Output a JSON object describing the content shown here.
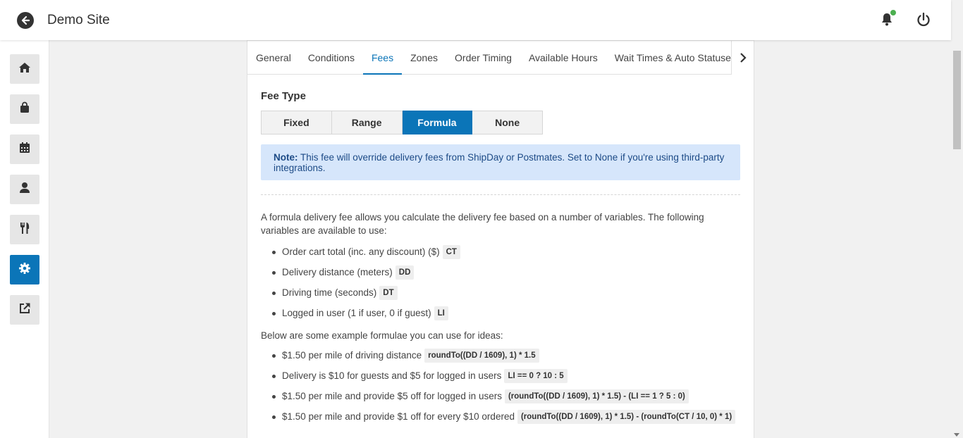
{
  "header": {
    "title": "Demo Site"
  },
  "sidebar": {
    "items": [
      {
        "icon": "home-icon",
        "active": false
      },
      {
        "icon": "shopping-bag-icon",
        "active": false
      },
      {
        "icon": "calendar-icon",
        "active": false
      },
      {
        "icon": "user-icon",
        "active": false
      },
      {
        "icon": "utensils-icon",
        "active": false
      },
      {
        "icon": "gear-icon",
        "active": true
      },
      {
        "icon": "external-link-icon",
        "active": false
      }
    ]
  },
  "tabs": [
    "General",
    "Conditions",
    "Fees",
    "Zones",
    "Order Timing",
    "Available Hours",
    "Wait Times & Auto Statuses"
  ],
  "active_tab": "Fees",
  "fee_type": {
    "label": "Fee Type",
    "options": [
      "Fixed",
      "Range",
      "Formula",
      "None"
    ],
    "selected": "Formula"
  },
  "note": {
    "title": "Note:",
    "text": "This fee will override delivery fees from ShipDay or Postmates. Set to None if you're using third-party integrations."
  },
  "intro": "A formula delivery fee allows you calculate the delivery fee based on a number of variables. The following variables are available to use:",
  "variables": [
    {
      "text": "Order cart total (inc. any discount) ($)",
      "code": "CT"
    },
    {
      "text": "Delivery distance (meters)",
      "code": "DD"
    },
    {
      "text": "Driving time (seconds)",
      "code": "DT"
    },
    {
      "text": "Logged in user (1 if user, 0 if guest)",
      "code": "LI"
    }
  ],
  "examples_intro": "Below are some example formulae you can use for ideas:",
  "examples": [
    {
      "text": "$1.50 per mile of driving distance",
      "code": "roundTo((DD / 1609), 1) * 1.5"
    },
    {
      "text": "Delivery is $10 for guests and $5 for logged in users",
      "code": "LI == 0 ? 10 : 5"
    },
    {
      "text": "$1.50 per mile and provide $5 off for logged in users",
      "code": "(roundTo((DD / 1609), 1) * 1.5) - (LI == 1 ? 5 : 0)"
    },
    {
      "text": "$1.50 per mile and provide $1 off for every $10 ordered",
      "code": "(roundTo((DD / 1609), 1) * 1.5) - (roundTo(CT / 10, 0) * 1)"
    }
  ],
  "colors": {
    "accent": "#0b75b8",
    "note_bg": "#d6e6fb",
    "note_text": "#1c4a86",
    "notification": "#4caf50"
  }
}
